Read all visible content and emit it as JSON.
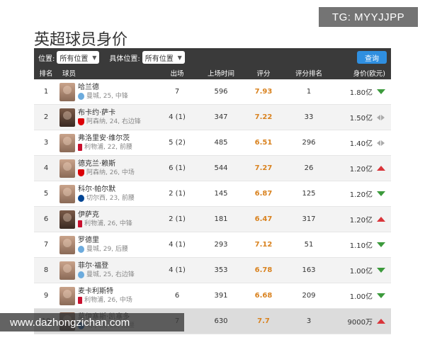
{
  "watermark_top": "TG: MYYJJPP",
  "watermark_bottom": "www.dazhongzichan.com",
  "title": "英超球员身价",
  "filters": {
    "position_label": "位置:",
    "position_value": "所有位置",
    "specific_label": "具体位置:",
    "specific_value": "所有位置",
    "query_label": "查询"
  },
  "headers": {
    "rank": "排名",
    "player": "球员",
    "apps": "出场",
    "minutes": "上场时间",
    "rating": "评分",
    "rating_rank": "评分排名",
    "value": "身价(欧元)"
  },
  "colors": {
    "header_bg": "#3a3a3a",
    "rating": "#d9821f",
    "trend_down": "#3c9a3c",
    "trend_up": "#d9343a",
    "query_button": "#2f8fe0"
  },
  "rows": [
    {
      "rank": "1",
      "name": "哈兰德",
      "info": "曼城, 25, 中锋",
      "club": "mancity",
      "apps": "7",
      "minutes": "596",
      "rating": "7.93",
      "rating_rank": "1",
      "value": "1.80亿",
      "trend": "down"
    },
    {
      "rank": "2",
      "name": "布卡约·萨卡",
      "info": "阿森纳, 24, 右边锋",
      "club": "arsenal",
      "apps": "4 (1)",
      "minutes": "347",
      "rating": "7.22",
      "rating_rank": "33",
      "value": "1.50亿",
      "trend": "flat"
    },
    {
      "rank": "3",
      "name": "弗洛里安·维尔茨",
      "info": "利物浦, 22, 前腰",
      "club": "liverpool",
      "apps": "5 (2)",
      "minutes": "485",
      "rating": "6.51",
      "rating_rank": "296",
      "value": "1.40亿",
      "trend": "flat"
    },
    {
      "rank": "4",
      "name": "德克兰·赖斯",
      "info": "阿森纳, 26, 中场",
      "club": "arsenal",
      "apps": "6 (1)",
      "minutes": "544",
      "rating": "7.27",
      "rating_rank": "26",
      "value": "1.20亿",
      "trend": "up"
    },
    {
      "rank": "5",
      "name": "科尔·帕尔默",
      "info": "切尔西, 23, 前腰",
      "club": "chelsea",
      "apps": "2 (1)",
      "minutes": "145",
      "rating": "6.87",
      "rating_rank": "125",
      "value": "1.20亿",
      "trend": "down"
    },
    {
      "rank": "6",
      "name": "伊萨克",
      "info": "利物浦, 26, 中锋",
      "club": "liverpool",
      "apps": "2 (1)",
      "minutes": "181",
      "rating": "6.47",
      "rating_rank": "317",
      "value": "1.20亿",
      "trend": "up"
    },
    {
      "rank": "7",
      "name": "罗德里",
      "info": "曼城, 29, 后腰",
      "club": "mancity",
      "apps": "4 (1)",
      "minutes": "293",
      "rating": "7.12",
      "rating_rank": "51",
      "value": "1.10亿",
      "trend": "down"
    },
    {
      "rank": "8",
      "name": "菲尔·福登",
      "info": "曼城, 25, 右边锋",
      "club": "mancity",
      "apps": "4 (1)",
      "minutes": "353",
      "rating": "6.78",
      "rating_rank": "163",
      "value": "1.00亿",
      "trend": "down"
    },
    {
      "rank": "9",
      "name": "麦卡利斯特",
      "info": "利物浦, 26, 中场",
      "club": "liverpool",
      "apps": "6",
      "minutes": "391",
      "rating": "6.68",
      "rating_rank": "209",
      "value": "1.00亿",
      "trend": "down"
    },
    {
      "rank": "10",
      "name": "莫伊塞斯·凯塞多",
      "info": "切尔西, 23, 后腰",
      "club": "chelsea",
      "apps": "7",
      "minutes": "630",
      "rating": "7.7",
      "rating_rank": "3",
      "value": "9000万",
      "trend": "up"
    }
  ]
}
